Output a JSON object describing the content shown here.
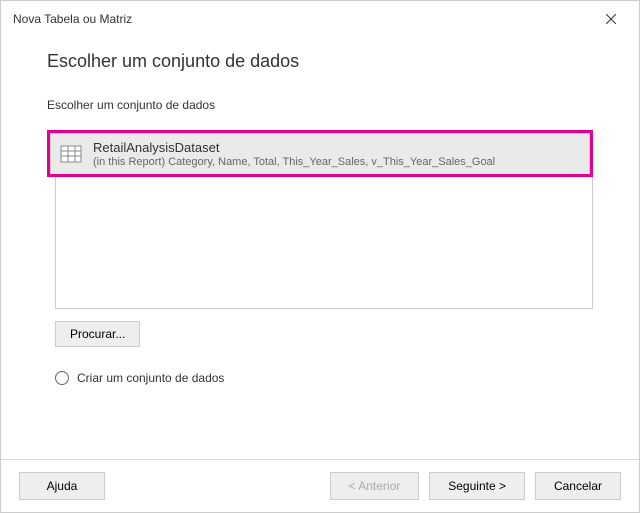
{
  "window": {
    "title": "Nova Tabela ou Matriz"
  },
  "main": {
    "heading": "Escolher um conjunto de dados",
    "subheading": "Escolher um conjunto de dados",
    "dataset": {
      "name": "RetailAnalysisDataset",
      "fields": "(in this Report) Category, Name, Total, This_Year_Sales, v_This_Year_Sales_Goal"
    },
    "browse_label": "Procurar...",
    "create_option": "Criar um conjunto de dados"
  },
  "buttons": {
    "help": "Ajuda",
    "back": "< Anterior",
    "next": "Seguinte >",
    "cancel": "Cancelar"
  }
}
